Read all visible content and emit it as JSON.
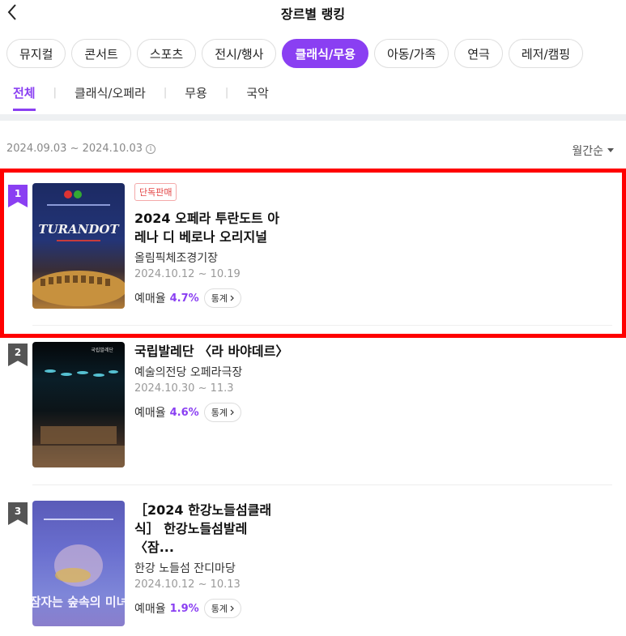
{
  "header": {
    "title": "장르별 랭킹"
  },
  "genres": [
    {
      "label": "뮤지컬",
      "active": false
    },
    {
      "label": "콘서트",
      "active": false
    },
    {
      "label": "스포츠",
      "active": false
    },
    {
      "label": "전시/행사",
      "active": false
    },
    {
      "label": "클래식/무용",
      "active": true
    },
    {
      "label": "아동/가족",
      "active": false
    },
    {
      "label": "연극",
      "active": false
    },
    {
      "label": "레저/캠핑",
      "active": false
    }
  ],
  "subtabs": [
    {
      "label": "전체",
      "active": true
    },
    {
      "label": "클래식/오페라",
      "active": false
    },
    {
      "label": "무용",
      "active": false
    },
    {
      "label": "국악",
      "active": false
    }
  ],
  "period": {
    "range": "2024.09.03 ~ 2024.10.03",
    "sort_label": "월간순"
  },
  "ranking": [
    {
      "rank": "1",
      "badge": "단독판매",
      "title": "2024 오페라 투란도트 아레나 디 베로나 오리지널",
      "venue": "올림픽체조경기장",
      "dates": "2024.10.12 ~ 10.19",
      "rate_label": "예매율",
      "rate": "4.7%",
      "stats_label": "통계",
      "poster_text": "TURANDOT"
    },
    {
      "rank": "2",
      "badge": "",
      "title": "국립발레단 〈라 바야데르〉",
      "venue": "예술의전당 오페라극장",
      "dates": "2024.10.30 ~ 11.3",
      "rate_label": "예매율",
      "rate": "4.6%",
      "stats_label": "통계",
      "poster_text": "국립발레단"
    },
    {
      "rank": "3",
      "badge": "",
      "title": "［2024 한강노들섬클래식］ 한강노들섬발레〈잠...",
      "venue": "한강 노들섬 잔디마당",
      "dates": "2024.10.12 ~ 10.13",
      "rate_label": "예매율",
      "rate": "1.9%",
      "stats_label": "통계",
      "poster_text": "잠자는 숲속의 미녀"
    }
  ],
  "colors": {
    "accent": "#8a3ff2",
    "highlight": "#ff0000",
    "exclusive": "#e34545"
  }
}
